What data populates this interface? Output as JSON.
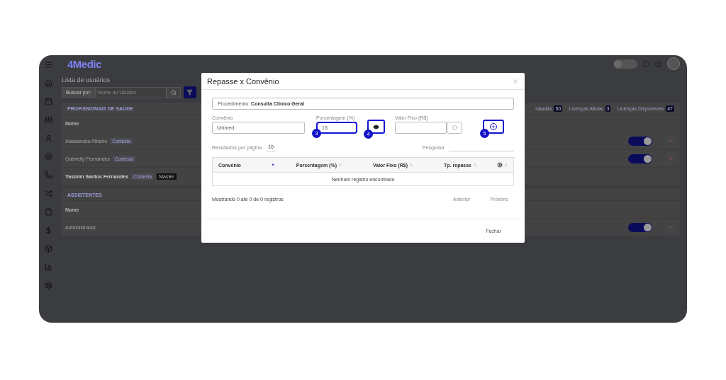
{
  "app": {
    "logo": "4Medic",
    "theme_toggle": {
      "on": false
    }
  },
  "page": {
    "title": "Lista de usuários",
    "search": {
      "label": "Buscar por:",
      "placeholder": "Nome ou Usuário"
    },
    "sections": [
      {
        "title": "PROFISSIONAIS DE SAÚDE",
        "stats": [
          {
            "label": "ratadas",
            "count": "50"
          },
          {
            "label": "Licenças Ativas",
            "count": "3"
          },
          {
            "label": "Licenças Disponíveis",
            "count": "47"
          }
        ],
        "column": "Nome",
        "rows": [
          {
            "name": "Alessandra Ribeiro",
            "bold": false,
            "tags": [
              {
                "text": "Cortesia",
                "kind": "light"
              }
            ],
            "active": true
          },
          {
            "name": "Gabrielly Fernandes",
            "bold": false,
            "tags": [
              {
                "text": "Cortesia",
                "kind": "light"
              }
            ],
            "active": true
          },
          {
            "name": "Yasmim Santos Fernandes",
            "bold": true,
            "tags": [
              {
                "text": "Cortesia",
                "kind": "light"
              },
              {
                "text": "Master",
                "kind": "dark"
              }
            ]
          }
        ]
      },
      {
        "title": "ASSISTENTES",
        "column": "Nome",
        "rows": [
          {
            "name": "Administrador",
            "bold": false,
            "tags": [],
            "active": true
          }
        ]
      }
    ]
  },
  "modal": {
    "title": "Repasse x Convênio",
    "procedure": "Procedimento: **Consulta Clínico Geral**",
    "fields": {
      "insurer": {
        "label": "Convênio",
        "value": "Unimed"
      },
      "percent": {
        "label": "Porcentagem (%)",
        "value": "15",
        "callout": "3"
      },
      "toggle_button": {
        "callout": "4"
      },
      "fixed": {
        "label": "Valor Fixo (R$)"
      },
      "add_button": {
        "callout": "5"
      }
    },
    "page_size": {
      "label": "Resultados por página",
      "value": "10"
    },
    "search_label": "Pesquisar",
    "table": {
      "columns": [
        {
          "label": "Convênio",
          "sorted": true
        },
        {
          "label": "Porcentagem (%)",
          "sorted": false
        },
        {
          "label": "Valor Fixo (R$)",
          "sorted": false
        },
        {
          "label": "Tp. repasse",
          "sorted": false
        },
        {
          "kind": "icon",
          "sorted": false
        }
      ],
      "empty": "Nenhum registro encontrado"
    },
    "info": "Mostrando 0 até 0 de 0 registros",
    "prev": "Anterior",
    "next": "Próximo",
    "close": "Fechar"
  }
}
